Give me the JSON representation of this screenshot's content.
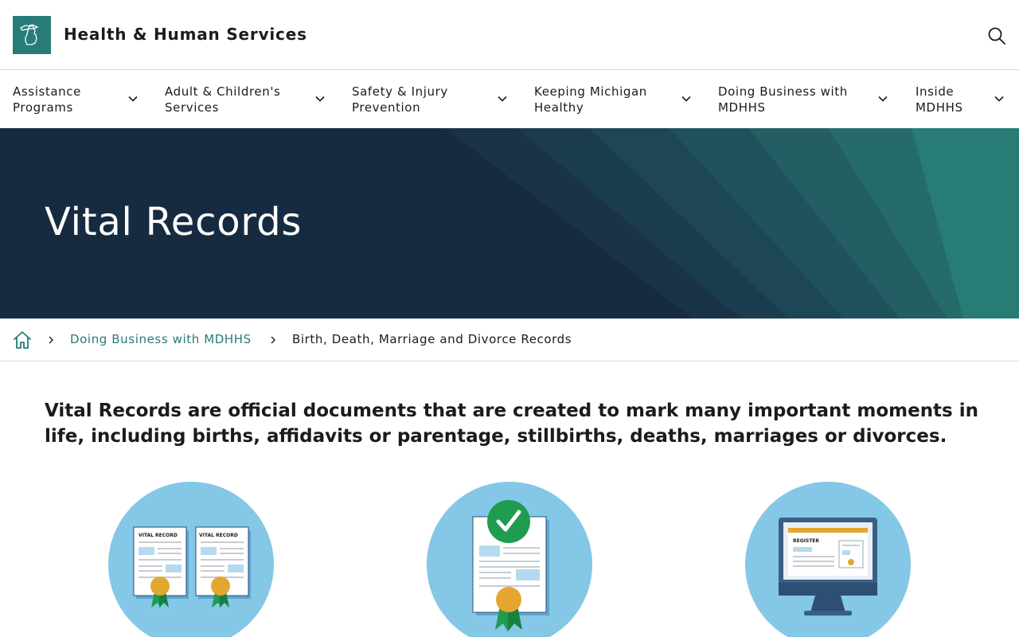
{
  "header": {
    "site_title": "Health & Human Services",
    "logo_icon": "michigan-state-icon",
    "search_icon": "search-icon"
  },
  "nav": {
    "items": [
      {
        "label": "Assistance Programs",
        "line1": "Assistance",
        "line2": "Programs"
      },
      {
        "label": "Adult & Children's Services",
        "line1": "Adult & Children's",
        "line2": "Services"
      },
      {
        "label": "Safety & Injury Prevention",
        "line1": "Safety & Injury",
        "line2": "Prevention"
      },
      {
        "label": "Keeping Michigan Healthy",
        "line1": "Keeping Michigan",
        "line2": "Healthy"
      },
      {
        "label": "Doing Business with MDHHS",
        "line1": "Doing Business with",
        "line2": "MDHHS"
      },
      {
        "label": "Inside MDHHS",
        "line1": "Inside",
        "line2": "MDHHS"
      }
    ]
  },
  "hero": {
    "title": "Vital Records"
  },
  "breadcrumb": {
    "home_icon": "home-icon",
    "link": "Doing Business with MDHHS",
    "current": "Birth, Death, Marriage and Divorce Records"
  },
  "intro": {
    "text": "Vital Records are official documents that are created to mark many important moments in life, including births, affidavits or parentage, stillbirths, deaths, marriages or divorces."
  },
  "features": {
    "card1": {
      "doc_label_left": "VITAL RECORD",
      "doc_label_right": "VITAL RECORD"
    },
    "card3": {
      "screen_label": "REGISTER"
    }
  },
  "colors": {
    "brand_teal": "#277c78",
    "hero_navy": "#172b40",
    "icon_circle": "#84c7e7",
    "award_gold": "#e3a731",
    "ribbon_green": "#1f9c4f"
  }
}
